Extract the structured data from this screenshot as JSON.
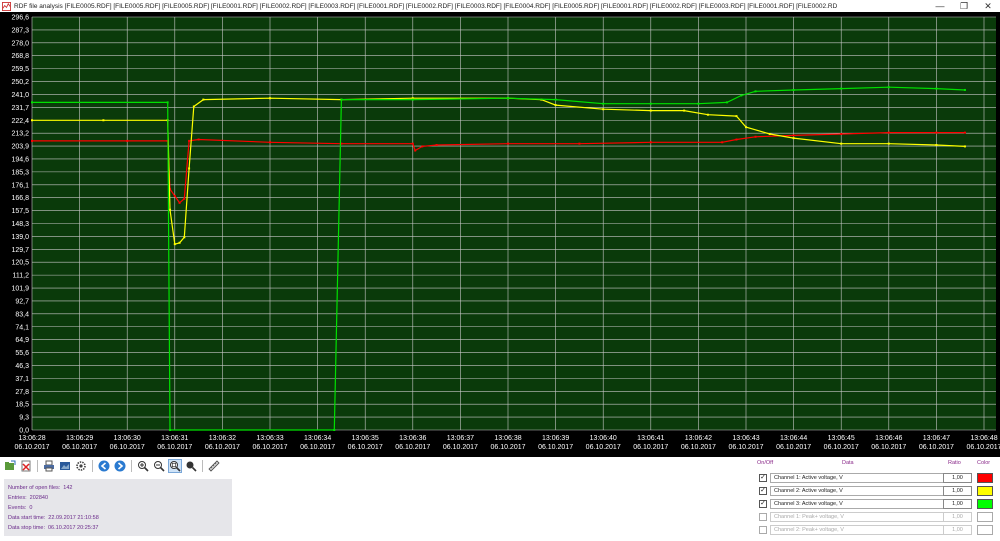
{
  "window": {
    "title": "RDF file analysis [FILE0005.RDF] [FILE0005.RDF] [FILE0005.RDF] [FILE0001.RDF] [FILE0002.RDF] [FILE0003.RDF] [FILE0001.RDF] [FILE0002.RDF] [FILE0003.RDF] [FILE0004.RDF] [FILE0005.RDF] [FILE0001.RDF] [FILE0002.RDF] [FILE0003.RDF] [FILE0001.RDF] [FILE0002.RD",
    "minimize": "—",
    "maximize": "❐",
    "close": "✕"
  },
  "chart_data": {
    "type": "line",
    "background": "#0a3a0a",
    "grid": true,
    "grid_color": "#c8c8c8",
    "ylim": [
      0,
      300
    ],
    "y_ticks": [
      "296,6",
      "287,3",
      "278,0",
      "268,8",
      "259,5",
      "250,2",
      "241,0",
      "231,7",
      "222,4",
      "213,2",
      "203,9",
      "194,6",
      "185,3",
      "176,1",
      "166,8",
      "157,5",
      "148,3",
      "139,0",
      "129,7",
      "120,5",
      "111,2",
      "101,9",
      "92,7",
      "83,4",
      "74,1",
      "64,9",
      "55,6",
      "46,3",
      "37,1",
      "27,8",
      "18,5",
      "9,3",
      "0,0"
    ],
    "x_ticks": [
      {
        "time": "13:06:28",
        "date": "06.10.2017"
      },
      {
        "time": "13:06:29",
        "date": "06.10.2017"
      },
      {
        "time": "13:06:30",
        "date": "06.10.2017"
      },
      {
        "time": "13:06:31",
        "date": "06.10.2017"
      },
      {
        "time": "13:06:32",
        "date": "06.10.2017"
      },
      {
        "time": "13:06:33",
        "date": "06.10.2017"
      },
      {
        "time": "13:06:34",
        "date": "06.10.2017"
      },
      {
        "time": "13:06:35",
        "date": "06.10.2017"
      },
      {
        "time": "13:06:36",
        "date": "06.10.2017"
      },
      {
        "time": "13:06:37",
        "date": "06.10.2017"
      },
      {
        "time": "13:06:38",
        "date": "06.10.2017"
      },
      {
        "time": "13:06:39",
        "date": "06.10.2017"
      },
      {
        "time": "13:06:40",
        "date": "06.10.2017"
      },
      {
        "time": "13:06:41",
        "date": "06.10.2017"
      },
      {
        "time": "13:06:42",
        "date": "06.10.2017"
      },
      {
        "time": "13:06:43",
        "date": "06.10.2017"
      },
      {
        "time": "13:06:44",
        "date": "06.10.2017"
      },
      {
        "time": "13:06:45",
        "date": "06.10.2017"
      },
      {
        "time": "13:06:46",
        "date": "06.10.2017"
      },
      {
        "time": "13:06:47",
        "date": "06.10.2017"
      },
      {
        "time": "13:06:48",
        "date": "06.10.2017"
      }
    ],
    "series": [
      {
        "name": "Channel 1: Active voltage, V",
        "color": "#ff0000",
        "points": [
          [
            0,
            210
          ],
          [
            2.0,
            210
          ],
          [
            2.85,
            210
          ],
          [
            2.9,
            175
          ],
          [
            3.0,
            170
          ],
          [
            3.1,
            165
          ],
          [
            3.2,
            168
          ],
          [
            3.3,
            210
          ],
          [
            3.5,
            211
          ],
          [
            5.0,
            209
          ],
          [
            6.5,
            208
          ],
          [
            8.0,
            208
          ],
          [
            8.05,
            203
          ],
          [
            8.2,
            206
          ],
          [
            8.5,
            207
          ],
          [
            10,
            208
          ],
          [
            11.5,
            208
          ],
          [
            13,
            209
          ],
          [
            14.5,
            209
          ],
          [
            14.8,
            211
          ],
          [
            15.2,
            213
          ],
          [
            16,
            214
          ],
          [
            17,
            215
          ],
          [
            18,
            216
          ],
          [
            19,
            216
          ],
          [
            19.6,
            216
          ]
        ]
      },
      {
        "name": "Channel 2: Active voltage, V",
        "color": "#ffff00",
        "points": [
          [
            0,
            225
          ],
          [
            1.5,
            225
          ],
          [
            2.85,
            225
          ],
          [
            2.9,
            160
          ],
          [
            3.0,
            135
          ],
          [
            3.1,
            136
          ],
          [
            3.2,
            140
          ],
          [
            3.3,
            190
          ],
          [
            3.4,
            235
          ],
          [
            3.6,
            240
          ],
          [
            5,
            241
          ],
          [
            6.5,
            240
          ],
          [
            8,
            241
          ],
          [
            10,
            241
          ],
          [
            10.7,
            240
          ],
          [
            11,
            236
          ],
          [
            12,
            233
          ],
          [
            13,
            232
          ],
          [
            13.7,
            232
          ],
          [
            14.2,
            229
          ],
          [
            14.8,
            228
          ],
          [
            15.0,
            220
          ],
          [
            15.5,
            215
          ],
          [
            16,
            212
          ],
          [
            17,
            208
          ],
          [
            18,
            208
          ],
          [
            19,
            207
          ],
          [
            19.6,
            206
          ]
        ]
      },
      {
        "name": "Channel 3: Active voltage, V",
        "color": "#00e000",
        "points": [
          [
            0,
            238
          ],
          [
            2.85,
            238
          ],
          [
            2.9,
            0
          ],
          [
            6.35,
            0
          ],
          [
            6.5,
            240
          ],
          [
            8,
            240
          ],
          [
            10,
            241
          ],
          [
            11,
            240
          ],
          [
            12,
            237
          ],
          [
            13,
            237
          ],
          [
            14,
            237
          ],
          [
            14.6,
            238
          ],
          [
            14.9,
            243
          ],
          [
            15.2,
            246
          ],
          [
            16,
            247
          ],
          [
            17,
            248
          ],
          [
            18,
            249
          ],
          [
            19,
            248
          ],
          [
            19.6,
            247
          ]
        ]
      },
      {
        "name": "Channel 1: Peak+ voltage, V",
        "color": "#ffffff",
        "points": []
      },
      {
        "name": "Channel 2: Peak+ voltage, V",
        "color": "#ffffff",
        "points": []
      }
    ]
  },
  "toolbar": {
    "buttons": [
      "open-file-icon",
      "remove-file-icon",
      "print-icon",
      "save-image-icon",
      "settings-icon",
      "back-arrow-icon",
      "forward-arrow-icon",
      "zoom-in-icon",
      "zoom-out-icon",
      "zoom-area-icon",
      "zoom-fit-icon",
      "ruler-icon"
    ]
  },
  "info": {
    "open_files_label": "Number of open files:",
    "open_files_value": "142",
    "entries_label": "Entries:",
    "entries_value": "202840",
    "events_label": "Events:",
    "events_value": "0",
    "start_label": "Data start time:",
    "start_value": "22.09.2017 21:10:58",
    "stop_label": "Data stop time:",
    "stop_value": "06.10.2017 20:25:37"
  },
  "channels": {
    "header_onoff": "On/Off",
    "header_data": "Data",
    "header_ratio": "Ratio",
    "header_color": "Color",
    "rows": [
      {
        "checked": "✓",
        "label": "Channel 1: Active voltage, V",
        "ratio": "1,00",
        "color": "#ff0000",
        "enabled": true
      },
      {
        "checked": "✓",
        "label": "Channel 2: Active voltage, V",
        "ratio": "1,00",
        "color": "#ffff00",
        "enabled": true
      },
      {
        "checked": "✓",
        "label": "Channel 3: Active voltage, V",
        "ratio": "1,00",
        "color": "#00ff00",
        "enabled": true
      },
      {
        "checked": "",
        "label": "Channel 1: Peak+ voltage, V",
        "ratio": "1,00",
        "color": "#ffffff",
        "enabled": false
      },
      {
        "checked": "",
        "label": "Channel 2: Peak+ voltage, V",
        "ratio": "1,00",
        "color": "#ffffff",
        "enabled": false
      }
    ]
  }
}
